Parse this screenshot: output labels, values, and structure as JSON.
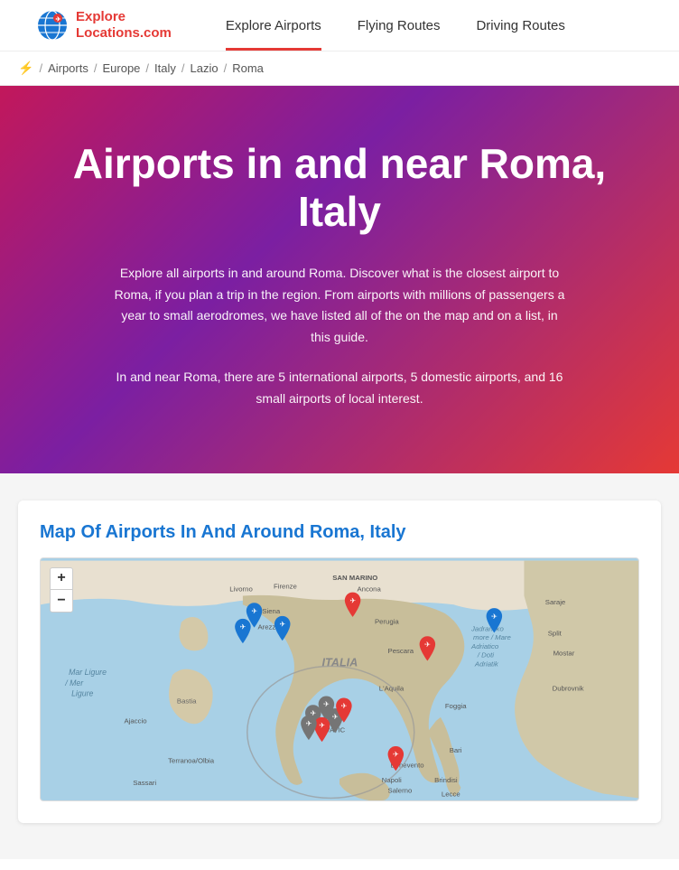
{
  "header": {
    "logo_line1": "Explore",
    "logo_line2": "Locations",
    "logo_com": ".com",
    "nav": [
      {
        "label": "Explore Airports",
        "active": true
      },
      {
        "label": "Flying Routes",
        "active": false
      },
      {
        "label": "Driving Routes",
        "active": false
      }
    ]
  },
  "breadcrumb": {
    "items": [
      "Airports",
      "Europe",
      "Italy",
      "Lazio",
      "Roma"
    ]
  },
  "hero": {
    "title": "Airports in and near Roma, Italy",
    "description1": "Explore all airports in and around Roma. Discover what is the closest airport to Roma, if you plan a trip in the region. From airports with millions of passengers a year to small aerodromes, we have listed all of the on the map and on a list, in this guide.",
    "description2": "In and near Roma, there are 5 international airports, 5 domestic airports, and 16 small airports of local interest."
  },
  "map_section": {
    "title_prefix": "Map Of Airports In And Around ",
    "title_location": "Roma, Italy",
    "zoom_in": "+",
    "zoom_out": "−"
  }
}
